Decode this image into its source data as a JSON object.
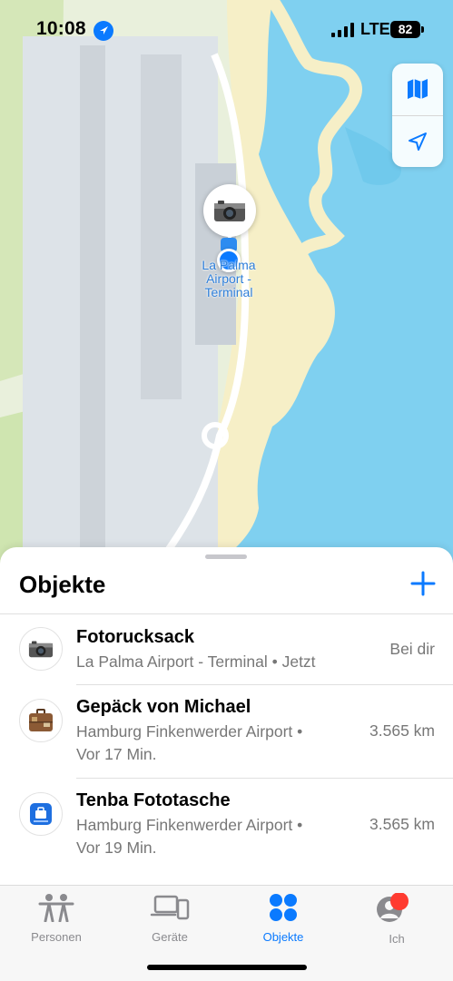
{
  "status_bar": {
    "time": "10:08",
    "network": "LTE",
    "battery": "82"
  },
  "map": {
    "poi_label": "La Palma Airport - Terminal",
    "controls": {
      "map_icon": "map-icon",
      "locate_icon": "location-arrow-icon"
    },
    "pin_icon": "camera-icon",
    "colors": {
      "water": "#7fd0f0",
      "land": "#e9f0dc",
      "sand": "#f6efc7",
      "runway": "#d6dbe0"
    }
  },
  "sheet": {
    "title": "Objekte",
    "add_icon": "plus-icon",
    "items": [
      {
        "name": "Fotorucksack",
        "line1": "La Palma Airport - Terminal • Jetzt",
        "line2": "",
        "distance": "Bei dir",
        "icon": "camera-icon"
      },
      {
        "name": "Gepäck von Michael",
        "line1": "Hamburg Finkenwerder Airport •",
        "line2": "Vor 17 Min.",
        "distance": "3.565 km",
        "icon": "suitcase-icon"
      },
      {
        "name": "Tenba Fototasche",
        "line1": "Hamburg Finkenwerder Airport •",
        "line2": "Vor 19 Min.",
        "distance": "3.565 km",
        "icon": "bag-icon"
      }
    ]
  },
  "tabbar": {
    "tabs": [
      {
        "label": "Personen",
        "icon": "people-icon"
      },
      {
        "label": "Geräte",
        "icon": "devices-icon"
      },
      {
        "label": "Objekte",
        "icon": "items-icon",
        "active": true
      },
      {
        "label": "Ich",
        "icon": "person-circle-icon",
        "badge": true
      }
    ],
    "accent": "#0a7aff",
    "badge_color": "#ff3b30"
  }
}
